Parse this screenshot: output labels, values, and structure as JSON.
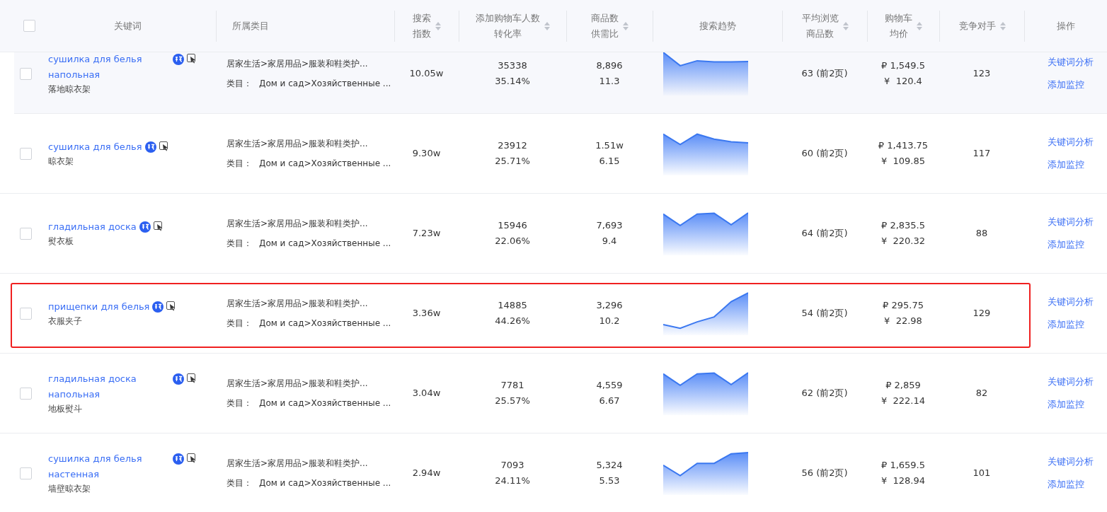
{
  "header": {
    "checked": false,
    "columns": [
      {
        "lines": [
          "关键词"
        ],
        "kind": "plain"
      },
      {
        "lines": [
          "所属类目"
        ],
        "kind": "plain"
      },
      {
        "lines": [
          "搜索",
          "指数"
        ],
        "kind": "sortable"
      },
      {
        "lines": [
          "添加购物车人数",
          "转化率"
        ],
        "kind": "sortable"
      },
      {
        "lines": [
          "商品数",
          "供需比"
        ],
        "kind": "sortable"
      },
      {
        "lines": [
          "搜索趋势"
        ],
        "kind": "plain"
      },
      {
        "lines": [
          "平均浏览",
          "商品数"
        ],
        "kind": "sortable"
      },
      {
        "lines": [
          "购物车",
          "均价"
        ],
        "kind": "sortable"
      },
      {
        "lines": [
          "竞争对手"
        ],
        "kind": "sortable"
      },
      {
        "lines": [
          "操作"
        ],
        "kind": "plain"
      }
    ]
  },
  "rows": [
    {
      "checked": false,
      "hovered": true,
      "highlighted": false,
      "keyword": "сушилка для белья напольная",
      "translation": "落地晾衣架",
      "category_cn": "居家生活>家居用品>服装和鞋类护...",
      "category_label": "类目：",
      "category_ru": "Дом и сад>Хозяйственные ...",
      "search_index": "10.05w",
      "add_to_cart": "35338",
      "conversion": "35.14%",
      "goods_count": "8,896",
      "supply_demand": "11.3",
      "avg_browse": "63 (前2页)",
      "price_rub": "₽ 1,549.5",
      "price_cny": "¥  120.4",
      "competitors": "123",
      "actions": [
        "关键词分析",
        "添加监控"
      ]
    },
    {
      "checked": false,
      "hovered": false,
      "highlighted": false,
      "keyword": "сушилка для белья",
      "translation": "晾衣架",
      "category_cn": "居家生活>家居用品>服装和鞋类护...",
      "category_label": "类目：",
      "category_ru": "Дом и сад>Хозяйственные ...",
      "search_index": "9.30w",
      "add_to_cart": "23912",
      "conversion": "25.71%",
      "goods_count": "1.51w",
      "supply_demand": "6.15",
      "avg_browse": "60 (前2页)",
      "price_rub": "₽ 1,413.75",
      "price_cny": "¥  109.85",
      "competitors": "117",
      "actions": [
        "关键词分析",
        "添加监控"
      ]
    },
    {
      "checked": false,
      "hovered": false,
      "highlighted": false,
      "keyword": "гладильная доска",
      "translation": "熨衣板",
      "category_cn": "居家生活>家居用品>服装和鞋类护...",
      "category_label": "类目：",
      "category_ru": "Дом и сад>Хозяйственные ...",
      "search_index": "7.23w",
      "add_to_cart": "15946",
      "conversion": "22.06%",
      "goods_count": "7,693",
      "supply_demand": "9.4",
      "avg_browse": "64 (前2页)",
      "price_rub": "₽ 2,835.5",
      "price_cny": "¥  220.32",
      "competitors": "88",
      "actions": [
        "关键词分析",
        "添加监控"
      ]
    },
    {
      "checked": false,
      "hovered": false,
      "highlighted": true,
      "keyword": "прищепки для белья",
      "translation": "衣服夹子",
      "category_cn": "居家生活>家居用品>服装和鞋类护...",
      "category_label": "类目：",
      "category_ru": "Дом и сад>Хозяйственные ...",
      "search_index": "3.36w",
      "add_to_cart": "14885",
      "conversion": "44.26%",
      "goods_count": "3,296",
      "supply_demand": "10.2",
      "avg_browse": "54 (前2页)",
      "price_rub": "₽ 295.75",
      "price_cny": "¥  22.98",
      "competitors": "129",
      "actions": [
        "关键词分析",
        "添加监控"
      ]
    },
    {
      "checked": false,
      "hovered": false,
      "highlighted": false,
      "keyword": "гладильная доска напольная",
      "translation": "地板熨斗",
      "category_cn": "居家生活>家居用品>服装和鞋类护...",
      "category_label": "类目：",
      "category_ru": "Дом и сад>Хозяйственные ...",
      "search_index": "3.04w",
      "add_to_cart": "7781",
      "conversion": "25.57%",
      "goods_count": "4,559",
      "supply_demand": "6.67",
      "avg_browse": "62 (前2页)",
      "price_rub": "₽ 2,859",
      "price_cny": "¥  222.14",
      "competitors": "82",
      "actions": [
        "关键词分析",
        "添加监控"
      ]
    },
    {
      "checked": false,
      "hovered": false,
      "highlighted": false,
      "keyword": "сушилка для белья настенная",
      "translation": "墙壁晾衣架",
      "category_cn": "居家生活>家居用品>服装和鞋类护...",
      "category_label": "类目：",
      "category_ru": "Дом и сад>Хозяйственные ...",
      "search_index": "2.94w",
      "add_to_cart": "7093",
      "conversion": "24.11%",
      "goods_count": "5,324",
      "supply_demand": "5.53",
      "avg_browse": "56 (前2页)",
      "price_rub": "₽ 1,659.5",
      "price_cny": "¥  128.94",
      "competitors": "101",
      "actions": [
        "关键词分析",
        "添加监控"
      ]
    }
  ]
}
